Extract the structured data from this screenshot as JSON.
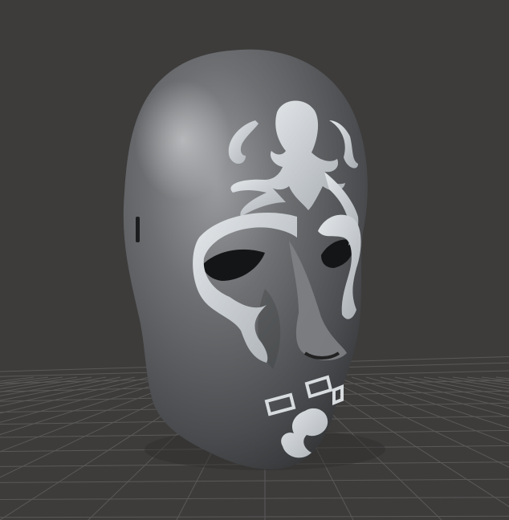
{
  "viewport": {
    "background_color": "#3d3c3b",
    "grid_color": "#5a5958",
    "model": {
      "type": "mask",
      "base_color": "#55575a",
      "pattern_color": "#cfd4d8",
      "pattern_motifs": [
        "octopus-motif",
        "scroll-ornament",
        "diamond-inlays"
      ]
    }
  }
}
